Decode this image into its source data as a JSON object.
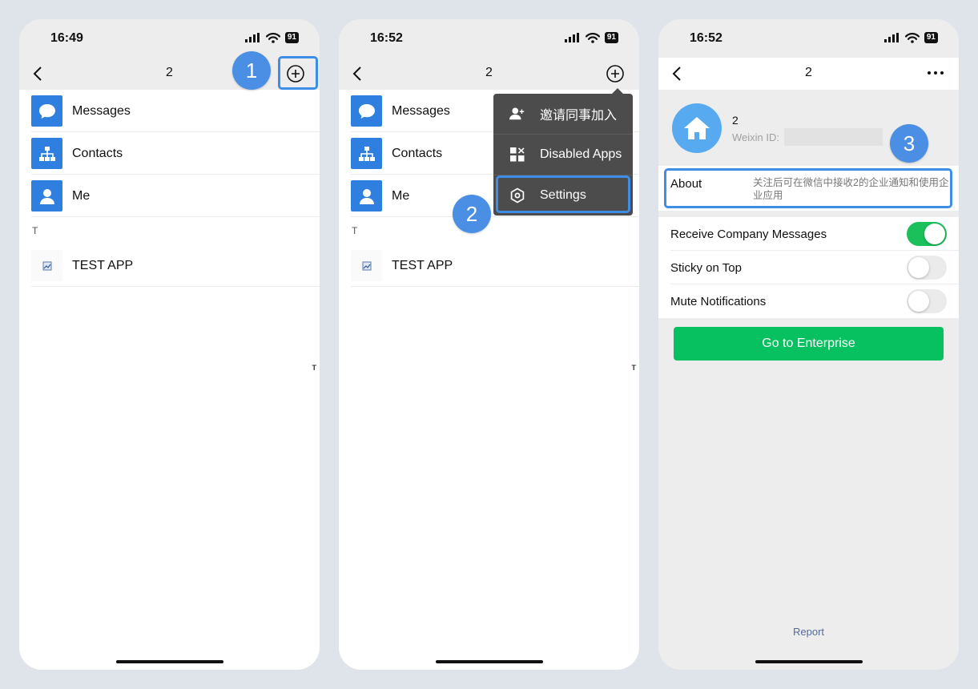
{
  "panels": [
    {
      "time": "16:49",
      "battery": "91",
      "title": "2",
      "items": [
        {
          "label": "Messages"
        },
        {
          "label": "Contacts"
        },
        {
          "label": "Me"
        }
      ],
      "section": "T",
      "app": {
        "label": "TEST APP"
      },
      "index_letter": "T"
    },
    {
      "time": "16:52",
      "battery": "91",
      "title": "2",
      "items": [
        {
          "label": "Messages"
        },
        {
          "label": "Contacts"
        },
        {
          "label": "Me"
        }
      ],
      "section": "T",
      "app": {
        "label": "TEST APP"
      },
      "index_letter": "T",
      "menu": [
        {
          "label": "邀请同事加入",
          "icon": "add-user-icon"
        },
        {
          "label": "Disabled Apps",
          "icon": "apps-icon"
        },
        {
          "label": "Settings",
          "icon": "gear-icon"
        }
      ]
    },
    {
      "time": "16:52",
      "battery": "91",
      "title": "2",
      "profile": {
        "name": "2",
        "id_label": "Weixin ID:"
      },
      "about": {
        "label": "About",
        "text": "关注后可在微信中接收2的企业通知和使用企业应用"
      },
      "toggles": [
        {
          "label": "Receive Company Messages",
          "on": true
        },
        {
          "label": "Sticky on Top",
          "on": false
        },
        {
          "label": "Mute Notifications",
          "on": false
        }
      ],
      "go_button": "Go to Enterprise",
      "report": "Report"
    }
  ],
  "badges": [
    "1",
    "2",
    "3"
  ],
  "colors": {
    "accent_blue": "#2f7fe1",
    "highlight": "#3e8de6",
    "wechat_green": "#07c160",
    "menu_bg": "#4c4c4c"
  }
}
